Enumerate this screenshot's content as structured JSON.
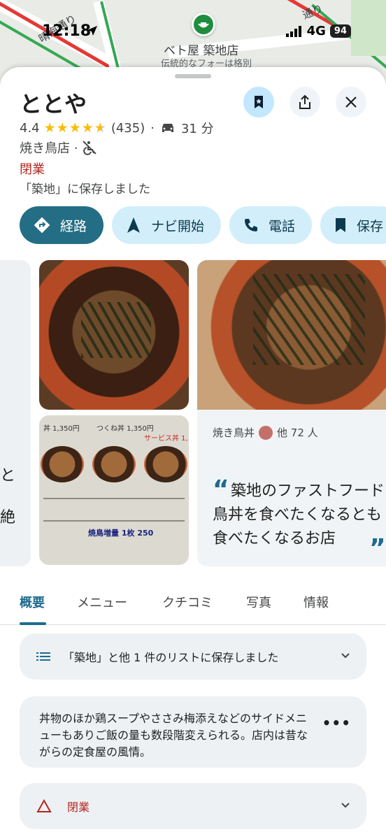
{
  "status_bar": {
    "time": "12:18",
    "network": "4G",
    "battery": "94"
  },
  "map": {
    "poi_label": "ベト屋 築地店",
    "poi_sublabel": "伝統的なフォーは格別",
    "street_left": "晴海通り",
    "street_right": "通り"
  },
  "place": {
    "name": "ととや",
    "rating": "4.4",
    "stars_full": 4,
    "review_count": "(435)",
    "drive_time": "31 分",
    "category": "焼き鳥店 ·",
    "status": "閉業",
    "saved_note": "「築地」に保存しました"
  },
  "actions": [
    {
      "label": "経路",
      "icon": "directions-icon"
    },
    {
      "label": "ナビ開始",
      "icon": "navigation-icon"
    },
    {
      "label": "電話",
      "icon": "phone-icon"
    },
    {
      "label": "保存",
      "icon": "bookmark-icon"
    }
  ],
  "photos": {
    "left_text_1": "と",
    "left_text_2": "絶",
    "review_dish": "焼き鳥丼",
    "review_others": "他 72 人",
    "review_quote": "築地のファストフード鳥丼を食べたくなるとも食べたくなるお店",
    "menu_items": [
      "丼 1,350円",
      "つくね丼 1,350円",
      "サービス丼 1,"
    ],
    "menu_extra": "焼鳥増量 1枚 250"
  },
  "tabs": [
    "概要",
    "メニュー",
    "クチコミ",
    "写真",
    "情報"
  ],
  "list_card": {
    "text": "「築地」と他 1 件のリストに保存しました"
  },
  "description": "丼物のほか鶏スープやささみ梅添えなどのサイドメニューもありご飯の量も数段階変えられる。店内は昔ながらの定食屋の風情。",
  "closed_card": {
    "text": "閉業"
  },
  "colors": {
    "accent": "#1e6b8f",
    "closed_red": "#b3261e",
    "star": "#fbbc04"
  }
}
